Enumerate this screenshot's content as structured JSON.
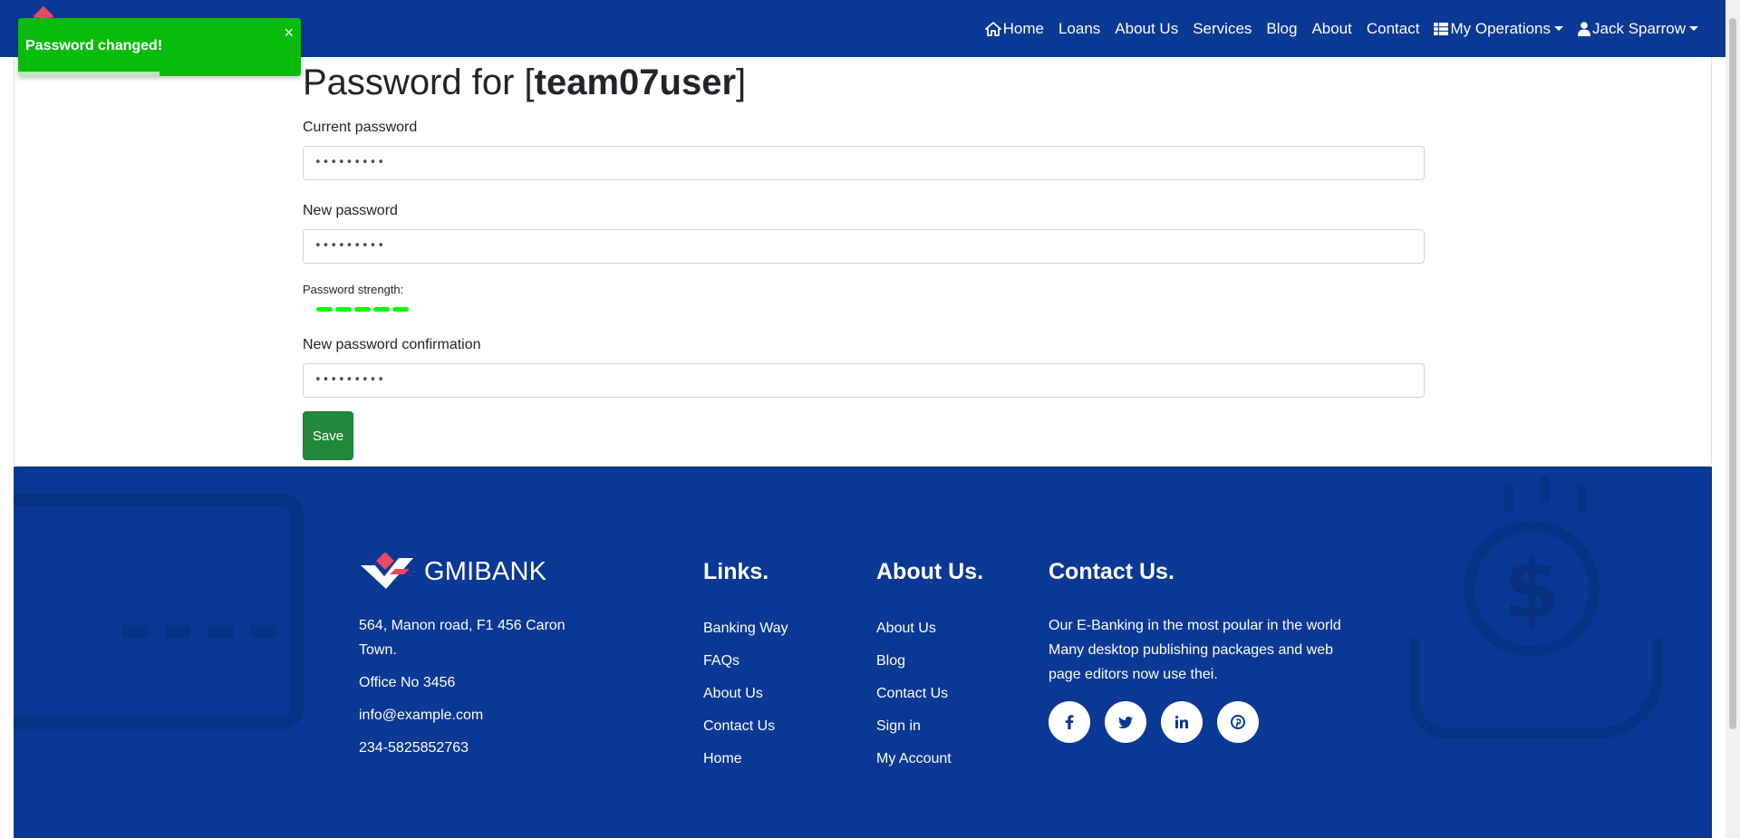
{
  "nav": {
    "home": "Home",
    "loans": "Loans",
    "about_us": "About Us",
    "services": "Services",
    "blog": "Blog",
    "about": "About",
    "contact": "Contact",
    "my_operations": "My Operations",
    "user": "Jack Sparrow"
  },
  "toast": {
    "message": "Password changed!",
    "close": "×",
    "progress": 0.5
  },
  "form": {
    "title_prefix": "Password for [",
    "username": "team07user",
    "title_suffix": "]",
    "current_label": "Current password",
    "current_value": "•••••••••",
    "new_label": "New password",
    "new_value": "•••••••••",
    "strength_label": "Password strength:",
    "strength_level": 5,
    "strength_max": 5,
    "confirm_label": "New password confirmation",
    "confirm_value": "•••••••••",
    "save_label": "Save"
  },
  "footer": {
    "brand": "GMIBANK",
    "address": "564, Manon road, F1 456 Caron Town.",
    "office": "Office No 3456",
    "email": "info@example.com",
    "phone": "234-5825852763",
    "links_heading": "Links.",
    "links": [
      "Banking Way",
      "FAQs",
      "About Us",
      "Contact Us",
      "Home"
    ],
    "about_heading": "About Us.",
    "about_links": [
      "About Us",
      "Blog",
      "Contact Us",
      "Sign in",
      "My Account"
    ],
    "contact_heading": "Contact Us.",
    "contact_desc": "Our E-Banking in the most poular in the world Many desktop publishing packages and web page editors now use thei.",
    "social": [
      "facebook-icon",
      "twitter-icon",
      "linkedin-icon",
      "pinterest-icon"
    ]
  },
  "colors": {
    "brand_blue": "#0a3895",
    "toast_green": "#07bc0c",
    "save_green": "#24883a",
    "strength_green": "#00ff00",
    "logo_pink": "#e84a5f"
  }
}
